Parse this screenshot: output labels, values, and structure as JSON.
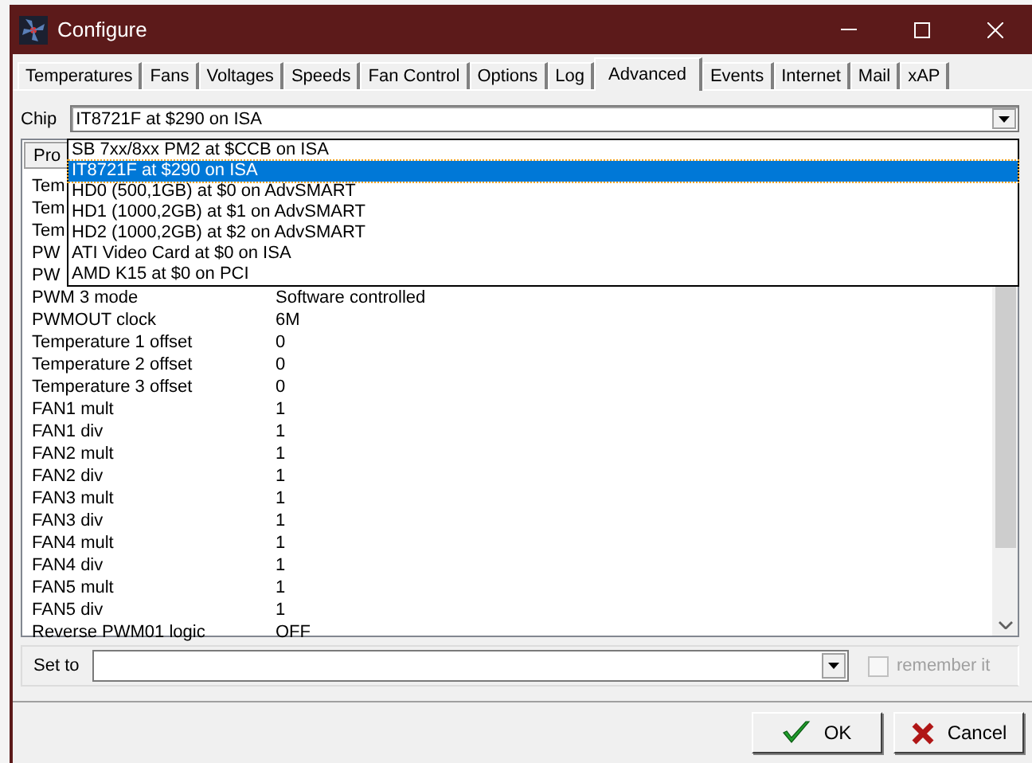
{
  "window": {
    "title": "Configure"
  },
  "tabs": [
    {
      "label": "Temperatures",
      "selected": false
    },
    {
      "label": "Fans",
      "selected": false
    },
    {
      "label": "Voltages",
      "selected": false
    },
    {
      "label": "Speeds",
      "selected": false
    },
    {
      "label": "Fan Control",
      "selected": false
    },
    {
      "label": "Options",
      "selected": false
    },
    {
      "label": "Log",
      "selected": false
    },
    {
      "label": "Advanced",
      "selected": true
    },
    {
      "label": "Events",
      "selected": false
    },
    {
      "label": "Internet",
      "selected": false
    },
    {
      "label": "Mail",
      "selected": false
    },
    {
      "label": "xAP",
      "selected": false
    }
  ],
  "chip": {
    "label": "Chip",
    "value": "IT8721F at $290 on ISA",
    "options": [
      {
        "label": "SB 7xx/8xx PM2 at $CCB on ISA",
        "selected": false
      },
      {
        "label": "IT8721F at $290 on ISA",
        "selected": true
      },
      {
        "label": "HD0 (500,1GB) at $0 on AdvSMART",
        "selected": false
      },
      {
        "label": "HD1 (1000,2GB) at $1 on AdvSMART",
        "selected": false
      },
      {
        "label": "HD2 (1000,2GB) at $2 on AdvSMART",
        "selected": false
      },
      {
        "label": "ATI Video Card at $0 on ISA",
        "selected": false
      },
      {
        "label": "AMD K15 at $0 on PCI",
        "selected": false
      }
    ]
  },
  "table": {
    "columns": [
      "Pro"
    ],
    "rows": [
      {
        "name": "Tem"
      },
      {
        "name": "Tem"
      },
      {
        "name": "Tem"
      },
      {
        "name": "PW"
      },
      {
        "name": "PW"
      },
      {
        "name": "PWM 3 mode",
        "value": "Software controlled"
      },
      {
        "name": "PWMOUT clock",
        "value": "6M"
      },
      {
        "name": "Temperature 1 offset",
        "value": "0"
      },
      {
        "name": "Temperature 2 offset",
        "value": "0"
      },
      {
        "name": "Temperature 3 offset",
        "value": "0"
      },
      {
        "name": "FAN1 mult",
        "value": "1"
      },
      {
        "name": "FAN1 div",
        "value": "1"
      },
      {
        "name": "FAN2 mult",
        "value": "1"
      },
      {
        "name": "FAN2 div",
        "value": "1"
      },
      {
        "name": "FAN3 mult",
        "value": "1"
      },
      {
        "name": "FAN3 div",
        "value": "1"
      },
      {
        "name": "FAN4 mult",
        "value": "1"
      },
      {
        "name": "FAN4 div",
        "value": "1"
      },
      {
        "name": "FAN5 mult",
        "value": "1"
      },
      {
        "name": "FAN5 div",
        "value": "1"
      },
      {
        "name": "Reverse PWM01 logic",
        "value": "OFF"
      }
    ]
  },
  "set_to": {
    "label": "Set to",
    "remember": {
      "label": "remember it",
      "checked": false,
      "disabled": true
    }
  },
  "buttons": [
    {
      "label": "OK",
      "kind": "ok"
    },
    {
      "label": "Cancel",
      "kind": "cancel"
    }
  ]
}
